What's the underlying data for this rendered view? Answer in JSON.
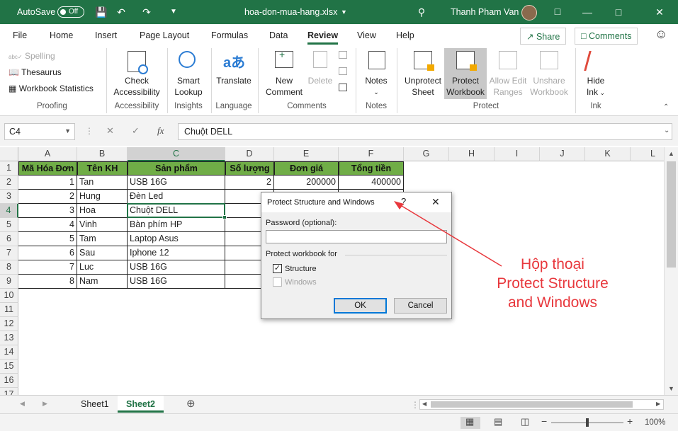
{
  "title_bar": {
    "autosave": "AutoSave",
    "autosave_state": "Off",
    "filename": "hoa-don-mua-hang.xlsx",
    "user": "Thanh Pham Van"
  },
  "menu": [
    "File",
    "Home",
    "Insert",
    "Page Layout",
    "Formulas",
    "Data",
    "Review",
    "View",
    "Help"
  ],
  "menu_active": "Review",
  "share": "Share",
  "comments": "Comments",
  "ribbon": {
    "spelling": "Spelling",
    "thesaurus": "Thesaurus",
    "workbook_statistics": "Workbook Statistics",
    "check_accessibility": [
      "Check",
      "Accessibility"
    ],
    "smart_lookup": [
      "Smart",
      "Lookup"
    ],
    "translate": "Translate",
    "new_comment": [
      "New",
      "Comment"
    ],
    "delete": "Delete",
    "notes": "Notes",
    "unprotect_sheet": [
      "Unprotect",
      "Sheet"
    ],
    "protect_workbook": [
      "Protect",
      "Workbook"
    ],
    "allow_edit_ranges": [
      "Allow Edit",
      "Ranges"
    ],
    "unshare_workbook": [
      "Unshare",
      "Workbook"
    ],
    "hide_ink": [
      "Hide",
      "Ink"
    ],
    "groups": [
      "Proofing",
      "Accessibility",
      "Insights",
      "Language",
      "Comments",
      "Notes",
      "Protect",
      "Ink"
    ]
  },
  "formula_bar": {
    "name_box": "C4",
    "formula": "Chuột DELL"
  },
  "columns": [
    "A",
    "B",
    "C",
    "D",
    "E",
    "F",
    "G",
    "H",
    "I",
    "J",
    "K",
    "L"
  ],
  "rows": [
    "1",
    "2",
    "3",
    "4",
    "5",
    "6",
    "7",
    "8",
    "9",
    "10",
    "11",
    "12",
    "13",
    "14",
    "15",
    "16",
    "17"
  ],
  "headers": [
    "Mã Hóa Đơn",
    "Tên KH",
    "Sản phẩm",
    "Số lượng",
    "Đơn giá",
    "Tổng tiền"
  ],
  "data": [
    [
      "1",
      "Tan",
      "USB 16G",
      "2",
      "200000",
      "400000"
    ],
    [
      "2",
      "Hung",
      "Đèn Led",
      "",
      "",
      ""
    ],
    [
      "3",
      "Hoa",
      "Chuột DELL",
      "",
      "",
      ""
    ],
    [
      "4",
      "Vinh",
      "Bàn phím HP",
      "",
      "",
      ""
    ],
    [
      "5",
      "Tam",
      "Laptop Asus",
      "",
      "",
      ""
    ],
    [
      "6",
      "Sau",
      "Iphone 12",
      "",
      "",
      ""
    ],
    [
      "7",
      "Luc",
      "USB 16G",
      "",
      "",
      ""
    ],
    [
      "8",
      "Nam",
      "USB 16G",
      "",
      "",
      ""
    ]
  ],
  "sheets": [
    "Sheet1",
    "Sheet2"
  ],
  "active_sheet": "Sheet2",
  "zoom": "100%",
  "dialog": {
    "title": "Protect Structure and Windows",
    "help": "?",
    "close": "✕",
    "password_label": "Password (optional):",
    "protect_for": "Protect workbook for",
    "structure": "Structure",
    "windows": "Windows",
    "ok": "OK",
    "cancel": "Cancel"
  },
  "annotation": [
    "Hộp thoại",
    "Protect Structure",
    "and Windows"
  ],
  "colors": {
    "excel_green": "#217346",
    "header_fill": "#70ad47",
    "annotation": "#e8383d"
  }
}
